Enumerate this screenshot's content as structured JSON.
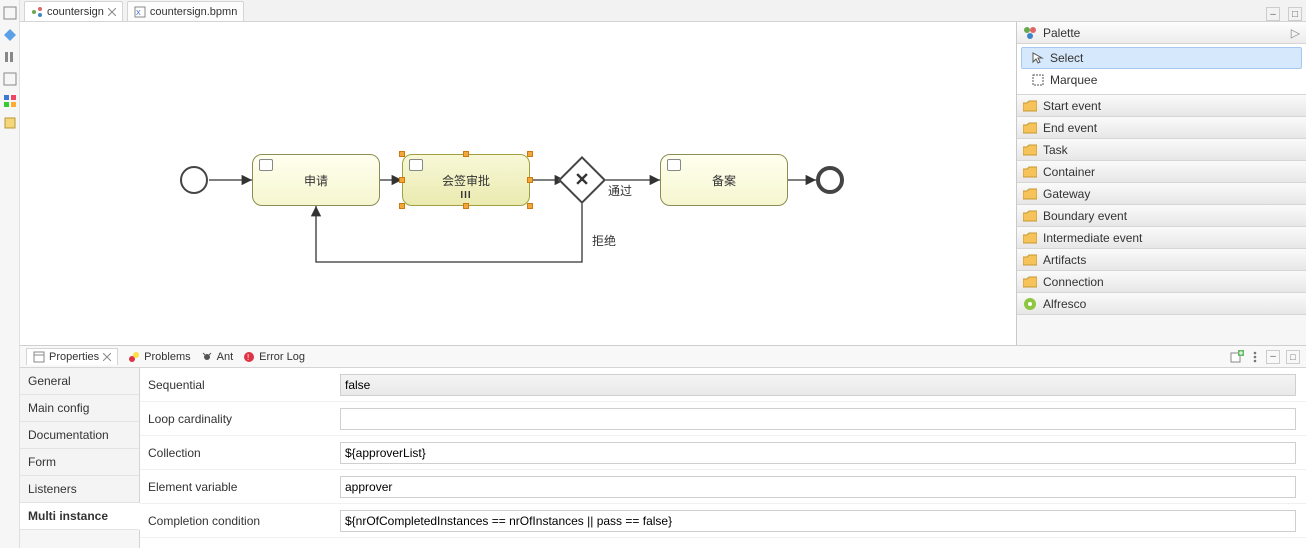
{
  "editorTabs": [
    {
      "label": "countersign",
      "active": true
    },
    {
      "label": "countersign.bpmn",
      "active": false
    }
  ],
  "bpmn": {
    "tasks": [
      {
        "label": "申请"
      },
      {
        "label": "会签审批"
      },
      {
        "label": "备案"
      }
    ],
    "edgeLabels": {
      "pass": "通过",
      "reject": "拒绝"
    }
  },
  "palette": {
    "title": "Palette",
    "tools": [
      {
        "label": "Select",
        "selected": true
      },
      {
        "label": "Marquee",
        "selected": false
      }
    ],
    "categories": [
      "Start event",
      "End event",
      "Task",
      "Container",
      "Gateway",
      "Boundary event",
      "Intermediate event",
      "Artifacts",
      "Connection",
      "Alfresco"
    ]
  },
  "views": {
    "tabs": [
      "Properties",
      "Problems",
      "Ant",
      "Error Log"
    ],
    "active": "Properties",
    "sideTabs": [
      "General",
      "Main config",
      "Documentation",
      "Form",
      "Listeners",
      "Multi instance"
    ],
    "sideActive": "Multi instance",
    "fields": [
      {
        "label": "Sequential",
        "value": "false",
        "shaded": true
      },
      {
        "label": "Loop cardinality",
        "value": "",
        "shaded": false
      },
      {
        "label": "Collection",
        "value": "${approverList}",
        "shaded": false
      },
      {
        "label": "Element variable",
        "value": "approver",
        "shaded": false
      },
      {
        "label": "Completion condition",
        "value": "${nrOfCompletedInstances == nrOfInstances || pass == false}",
        "shaded": false
      }
    ]
  }
}
